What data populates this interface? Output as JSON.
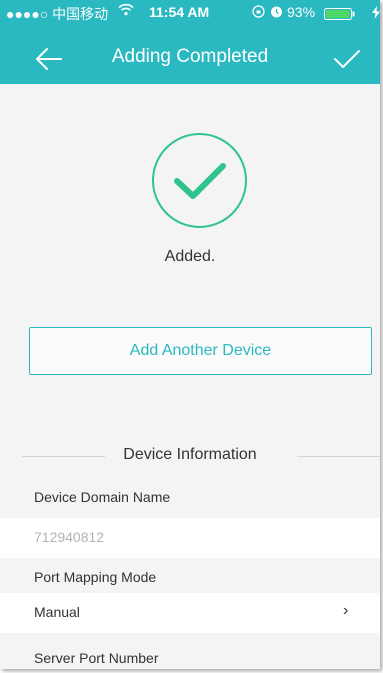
{
  "status_bar": {
    "carrier": "●●●●○ 中国移动",
    "time": "11:54 AM",
    "battery": "93%"
  },
  "nav": {
    "title": "Adding Completed"
  },
  "result": {
    "message": "Added."
  },
  "actions": {
    "add_another": "Add Another Device"
  },
  "section": {
    "title": "Device Information"
  },
  "fields": {
    "domain_label": "Device Domain Name",
    "domain_placeholder": "712940812",
    "port_mode_label": "Port Mapping Mode",
    "port_mode_value": "Manual",
    "server_port_label": "Server Port Number"
  },
  "colors": {
    "accent": "#2ab8c1",
    "success": "#2fc48c",
    "battery": "#4cd964"
  },
  "icons": [
    "wifi-icon",
    "lock-rotation-icon",
    "alarm-icon",
    "battery-icon",
    "charging-icon",
    "back-arrow-icon",
    "checkmark-icon",
    "success-check-icon",
    "chevron-right-icon"
  ]
}
